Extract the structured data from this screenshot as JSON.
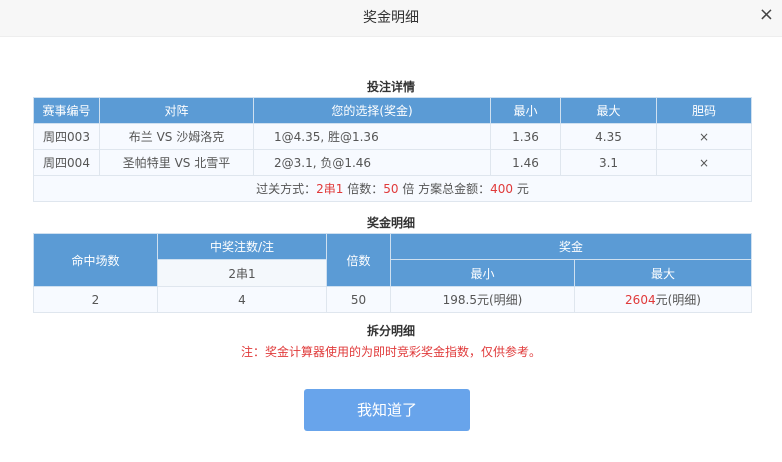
{
  "dialog": {
    "title": "奖金明细",
    "close": "×"
  },
  "bet": {
    "title": "投注详情",
    "headers": [
      "赛事编号",
      "对阵",
      "您的选择(奖金)",
      "最小",
      "最大",
      "胆码"
    ],
    "rows": [
      [
        "周四003",
        "布兰 VS 沙姆洛克",
        "1@4.35, 胜@1.36",
        "1.36",
        "4.35",
        "×"
      ],
      [
        "周四004",
        "圣帕特里 VS 北雪平",
        "2@3.1, 负@1.46",
        "1.46",
        "3.1",
        "×"
      ]
    ],
    "summary": {
      "pass_label": "过关方式：",
      "pass_value": "2串1",
      "multiple_label": " 倍数：",
      "multiple_value": "50",
      "multiple_unit": " 倍 方案总金额：",
      "amount_value": "400",
      "amount_unit": " 元"
    }
  },
  "prize": {
    "title": "奖金明细",
    "h_hits": "命中场数",
    "h_count": "中奖注数/注",
    "h_type": "2串1",
    "h_multiple": "倍数",
    "h_prize": "奖金",
    "h_min": "最小",
    "h_max": "最大",
    "row": {
      "hits": "2",
      "count": "4",
      "multiple": "50",
      "min": "198.5元(明细)",
      "max_value": "2604",
      "max_suffix": "元(明细)"
    }
  },
  "split": {
    "title": "拆分明细",
    "note": "注：奖金计算器使用的为即时竞彩奖金指数，仅供参考。"
  },
  "button": "我知道了"
}
